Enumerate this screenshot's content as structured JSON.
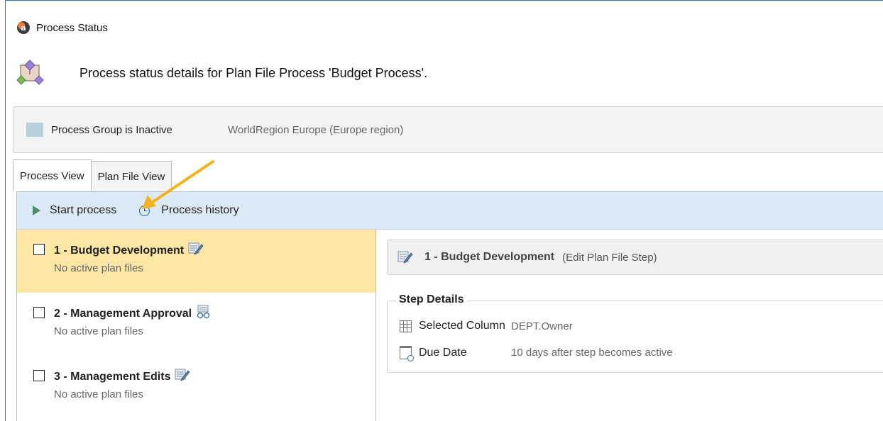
{
  "window": {
    "title": "Process Status",
    "app_icon_letter": "a"
  },
  "header": {
    "description": "Process status details for Plan File Process 'Budget Process'."
  },
  "group_bar": {
    "status": "Process Group is Inactive",
    "region": "WorldRegion Europe (Europe region)",
    "swatch_color": "#b9cfda"
  },
  "tabs": [
    {
      "label": "Process View",
      "active": true
    },
    {
      "label": "Plan File View",
      "active": false
    }
  ],
  "toolbar": {
    "start_label": "Start process",
    "history_label": "Process history"
  },
  "steps": [
    {
      "title": "1 - Budget Development",
      "subtitle": "No active plan files",
      "icon": "edit-plan-icon",
      "selected": true
    },
    {
      "title": "2 - Management Approval",
      "subtitle": "No active plan files",
      "icon": "approval-icon",
      "selected": false
    },
    {
      "title": "3 - Management Edits",
      "subtitle": "No active plan files",
      "icon": "edit-plan-icon",
      "selected": false
    }
  ],
  "detail": {
    "title": "1 - Budget Development",
    "type": "(Edit Plan File Step)",
    "section_title": "Step Details",
    "rows": [
      {
        "label": "Selected Column",
        "value": "DEPT.Owner",
        "icon": "grid-column-icon"
      },
      {
        "label": "Due Date",
        "value": "10 days after step becomes active",
        "icon": "calendar-search-icon"
      }
    ]
  },
  "annotation": {
    "arrow_color": "#f5b21b"
  }
}
